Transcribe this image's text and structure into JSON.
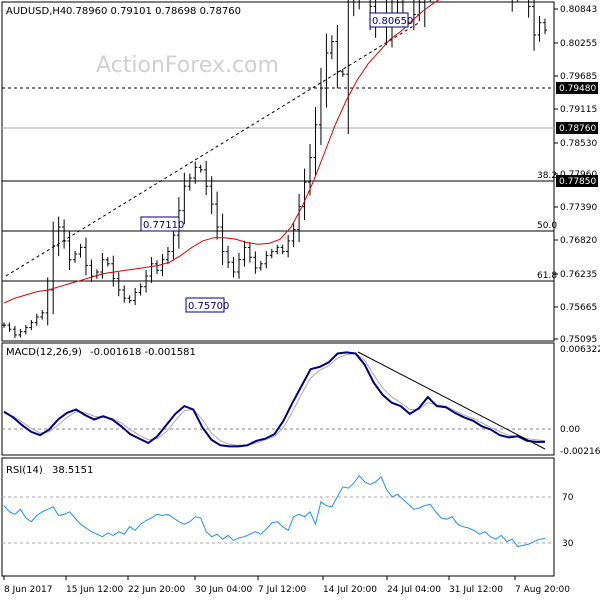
{
  "header": {
    "main_title": "AUDUSD,H4",
    "main_ohlc": "0.78960 0.79101 0.78698 0.78760",
    "macd_title": "MACD(12,26,9)",
    "macd_values": "-0.001618 -0.001581",
    "rsi_title": "RSI(14)",
    "rsi_value": "38.5151"
  },
  "watermark": "ActionForex.com",
  "colors": {
    "price_bar": "#000000",
    "moving_average": "#dd0000",
    "macd_line": "#000080",
    "signal_line": "#aaaaaa",
    "rsi_line": "#1e90ff",
    "level_line": "#000000",
    "label_box_border": "#000080",
    "current_price_tag": "#000000"
  },
  "chart_data": [
    {
      "type": "ohlc",
      "symbol": "AUDUSD",
      "timeframe": "H4",
      "ylim": [
        0.7498,
        0.7903
      ],
      "y_ticks": [
        "0.80843",
        "0.80255",
        "0.79685",
        "0.79115",
        "0.78530",
        "0.77960",
        "0.77390",
        "0.76820",
        "0.76235",
        "0.75665",
        "0.75095"
      ],
      "x_ticks": [
        "8 Jun 2017",
        "15 Jun 12:00",
        "22 Jun 20:00",
        "30 Jun 04:00",
        "7 Jul 12:00",
        "14 Jul 20:00",
        "24 Jul 04:00",
        "31 Jul 12:00",
        "7 Aug 20:00"
      ],
      "current_price": "0.78760",
      "level_tags": [
        "0.79480",
        "0.77850"
      ],
      "price_labels": [
        "0.80650",
        "0.77110",
        "0.75700"
      ],
      "fib_labels": [
        "38.2",
        "50.0",
        "61.8"
      ],
      "close": [
        0.7515,
        0.751,
        0.7503,
        0.7507,
        0.7512,
        0.7518,
        0.7525,
        0.753,
        0.7558,
        0.7612,
        0.7635,
        0.7618,
        0.7595,
        0.7602,
        0.761,
        0.7588,
        0.7575,
        0.758,
        0.7595,
        0.759,
        0.7572,
        0.7558,
        0.7548,
        0.7545,
        0.7555,
        0.7562,
        0.7575,
        0.759,
        0.7582,
        0.7595,
        0.7605,
        0.7625,
        0.7655,
        0.7685,
        0.7695,
        0.7708,
        0.7705,
        0.7685,
        0.7663,
        0.7635,
        0.7605,
        0.7592,
        0.758,
        0.7595,
        0.761,
        0.7598,
        0.7585,
        0.759,
        0.76,
        0.7605,
        0.761,
        0.7605,
        0.7618,
        0.7632,
        0.766,
        0.769,
        0.772,
        0.776,
        0.7805,
        0.7848,
        0.7862,
        0.7825,
        0.7822,
        0.7955,
        0.7915,
        0.794,
        0.7958,
        0.7905,
        0.7975,
        0.7935,
        0.7885,
        0.794,
        0.791,
        0.795,
        0.793,
        0.7895,
        0.791,
        0.7965,
        0.8065,
        0.802,
        0.797,
        0.7995,
        0.796,
        0.7975,
        0.803,
        0.7985,
        0.7965,
        0.7955,
        0.796,
        0.798,
        0.795,
        0.796,
        0.7945,
        0.7915,
        0.7922,
        0.793,
        0.7905,
        0.787,
        0.7885,
        0.7876
      ],
      "ma_close": [
        0.7542,
        0.7548,
        0.7552,
        0.7556,
        0.7558,
        0.7562,
        0.7566,
        0.757,
        0.7574,
        0.7578,
        0.758,
        0.7582,
        0.7584,
        0.7586,
        0.7588,
        0.7592,
        0.76,
        0.761,
        0.7618,
        0.7622,
        0.7622,
        0.762,
        0.7616,
        0.7614,
        0.7615,
        0.762,
        0.7635,
        0.766,
        0.769,
        0.7725,
        0.776,
        0.779,
        0.7815,
        0.7835,
        0.785,
        0.7865,
        0.7875,
        0.7888,
        0.79,
        0.791,
        0.7918,
        0.7928,
        0.794,
        0.7948,
        0.795,
        0.7945,
        0.7942,
        0.7938,
        0.793,
        0.7925
      ]
    },
    {
      "type": "line",
      "indicator": "MACD",
      "params": "12,26,9",
      "ylim": [
        -0.0026,
        0.0066
      ],
      "y_ticks": [
        "0.006322",
        "0.00",
        "-0.002164"
      ],
      "series": [
        {
          "name": "MACD",
          "values": [
            0.001,
            0.0005,
            -0.0002,
            -0.0008,
            -0.0011,
            -0.0006,
            0.0003,
            0.0009,
            0.0012,
            0.0007,
            0.0003,
            0.0006,
            0.0003,
            -0.0003,
            -0.001,
            -0.0014,
            -0.0018,
            -0.0012,
            -0.0002,
            0.0008,
            0.0015,
            0.0012,
            -0.0004,
            -0.0015,
            -0.002,
            -0.0021,
            -0.0021,
            -0.002,
            -0.0016,
            -0.0014,
            -0.001,
            0.0002,
            0.0018,
            0.0033,
            0.0048,
            0.005,
            0.0054,
            0.0062,
            0.0063,
            0.0062,
            0.0052,
            0.0036,
            0.0025,
            0.0018,
            0.0015,
            0.0008,
            0.0013,
            0.0023,
            0.0015,
            0.0014,
            0.0009,
            0.0005,
            0.0002,
            -0.0003,
            -0.0006,
            -0.0011,
            -0.0013,
            -0.0012,
            -0.0016,
            -0.0017,
            -0.0017
          ]
        },
        {
          "name": "Signal",
          "values": [
            0.0009,
            0.0006,
            0.0001,
            -0.0005,
            -0.0009,
            -0.0008,
            -0.0002,
            0.0005,
            0.001,
            0.0009,
            0.0006,
            0.0005,
            0.0004,
            0.0,
            -0.0006,
            -0.0011,
            -0.0015,
            -0.0014,
            -0.0008,
            0.0002,
            0.0011,
            0.0012,
            0.0003,
            -0.0009,
            -0.0016,
            -0.0019,
            -0.002,
            -0.002,
            -0.0018,
            -0.0015,
            -0.0012,
            -0.0004,
            0.001,
            0.0026,
            0.004,
            0.0047,
            0.0051,
            0.0058,
            0.0061,
            0.0062,
            0.0056,
            0.0043,
            0.0031,
            0.0023,
            0.0018,
            0.0012,
            0.0012,
            0.0018,
            0.0016,
            0.0015,
            0.0011,
            0.0007,
            0.0004,
            0.0,
            -0.0004,
            -0.0008,
            -0.0011,
            -0.0012,
            -0.0014,
            -0.0015,
            -0.0016
          ]
        }
      ]
    },
    {
      "type": "line",
      "indicator": "RSI",
      "params": "14",
      "ylim": [
        10,
        100
      ],
      "y_ticks": [
        "70",
        "30"
      ],
      "levels": [
        70,
        30
      ],
      "series": [
        {
          "name": "RSI",
          "values": [
            65,
            60,
            58,
            62,
            55,
            52,
            57,
            60,
            62,
            64,
            57,
            58,
            60,
            55,
            50,
            47,
            44,
            42,
            40,
            43,
            41,
            44,
            42,
            48,
            45,
            50,
            53,
            55,
            58,
            57,
            58,
            55,
            52,
            50,
            52,
            56,
            55,
            44,
            40,
            42,
            38,
            41,
            37,
            39,
            40,
            42,
            44,
            42,
            46,
            51,
            52,
            48,
            45,
            56,
            58,
            56,
            60,
            50,
            68,
            65,
            64,
            72,
            80,
            79,
            83,
            89,
            84,
            82,
            84,
            88,
            78,
            72,
            74,
            70,
            66,
            62,
            63,
            65,
            66,
            60,
            55,
            54,
            56,
            50,
            48,
            47,
            45,
            42,
            44,
            40,
            38,
            41,
            36,
            38,
            32,
            33,
            34,
            36,
            38,
            38.5
          ]
        }
      ]
    }
  ]
}
